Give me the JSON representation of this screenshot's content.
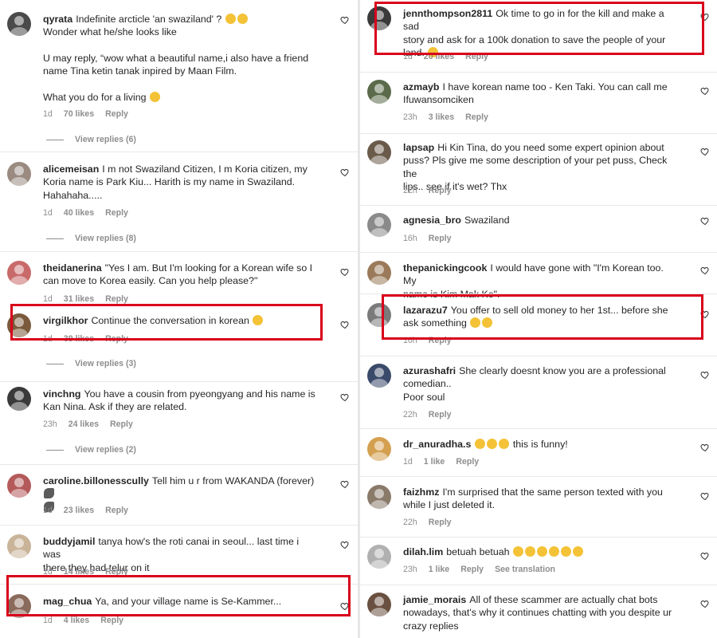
{
  "left": [
    {
      "user": "qyrata",
      "lines": [
        "Indefinite arcticle 'an swaziland' ?",
        "Wonder what he/she looks like",
        "",
        "U may reply, “wow what a beautiful name,i also have a friend",
        "name Tina ketin tanak inpired by Maan Film.",
        "",
        "What you do for a living"
      ],
      "time": "1d",
      "likes": "70 likes",
      "reply": "Reply",
      "view_replies": "View replies (6)",
      "avatar_color": "#4a4a4a"
    },
    {
      "user": "alicemeisan",
      "lines": [
        "I m not Swaziland Citizen, I m Koria citizen, my",
        "Koria name is Park Kiu... Harith is my name in Swaziland.",
        "Hahahaha....."
      ],
      "time": "1d",
      "likes": "40 likes",
      "reply": "Reply",
      "view_replies": "View replies (8)",
      "avatar_color": "#9a8a80"
    },
    {
      "user": "theidanerina",
      "lines": [
        "\"Yes I am. But I'm looking for a Korean wife so I",
        "can move to Korea easily. Can you help please?\""
      ],
      "time": "1d",
      "likes": "31 likes",
      "reply": "Reply",
      "avatar_color": "#c96a6a"
    },
    {
      "user": "virgilkhor",
      "lines": [
        "Continue the conversation in korean"
      ],
      "time": "1d",
      "likes": "39 likes",
      "reply": "Reply",
      "view_replies": "View replies (3)",
      "avatar_color": "#7a5a3a"
    },
    {
      "user": "vinchng",
      "lines": [
        "You have a cousin from pyeongyang and his name is",
        "Kan Nina. Ask if they are related."
      ],
      "time": "23h",
      "likes": "24 likes",
      "reply": "Reply",
      "view_replies": "View replies (2)",
      "avatar_color": "#3a3a3a"
    },
    {
      "user": "caroline.billonesscully",
      "lines": [
        "Tell him u r from WAKANDA (forever)"
      ],
      "time": "1d",
      "likes": "23 likes",
      "reply": "Reply",
      "avatar_color": "#b45a5a"
    },
    {
      "user": "buddyjamil",
      "lines": [
        "tanya how's the roti canai in seoul... last time i was",
        "there they had telur on it"
      ],
      "time": "1d",
      "likes": "14 likes",
      "reply": "Reply",
      "avatar_color": "#c9b49a"
    },
    {
      "user": "mag_chua",
      "lines": [
        "Ya, and your village name is Se-Kammer..."
      ],
      "time": "1d",
      "likes": "4 likes",
      "reply": "Reply",
      "avatar_color": "#8a6a5a"
    }
  ],
  "right": [
    {
      "user": "jennthompson2811",
      "lines": [
        "Ok time to go in for the kill and make a sad",
        "story and ask for a 100k donation to save the people of your",
        "land."
      ],
      "time": "1d",
      "likes": "20 likes",
      "reply": "Reply",
      "avatar_color": "#3a3a3a"
    },
    {
      "user": "azmayb",
      "lines": [
        "I have korean name too - Ken Taki. You can call me",
        "Ifuwansomciken"
      ],
      "time": "23h",
      "likes": "3 likes",
      "reply": "Reply",
      "avatar_color": "#5a6a4a"
    },
    {
      "user": "lapsap",
      "lines": [
        "Hi Kin Tina, do you need some expert opinion about",
        "puss? Pls give me some description of your pet puss, Check the",
        "lips.. see if it's wet? Thx"
      ],
      "time": "22h",
      "reply": "Reply",
      "avatar_color": "#6a5a4a"
    },
    {
      "user": "agnesia_bro",
      "lines": [
        "Swaziland"
      ],
      "time": "16h",
      "reply": "Reply",
      "avatar_color": "#8a8a8a"
    },
    {
      "user": "thepanickingcook",
      "lines": [
        "I would have gone with \"I'm Korean too. My",
        "name is Kim Mak Ko\"."
      ],
      "avatar_color": "#9a7a5a"
    },
    {
      "user": "lazarazu7",
      "lines": [
        "You offer to sell old money to her 1st... before she",
        "ask something"
      ],
      "time": "16h",
      "reply": "Reply",
      "avatar_color": "#7a7a7a"
    },
    {
      "user": "azurashafri",
      "lines": [
        "She clearly doesnt know you are a professional",
        "comedian..",
        "Poor soul"
      ],
      "time": "22h",
      "reply": "Reply",
      "avatar_color": "#3a4a6a"
    },
    {
      "user": "dr_anuradha.s",
      "lines": [
        "this is funny!"
      ],
      "time": "1d",
      "likes": "1 like",
      "reply": "Reply",
      "avatar_color": "#d4a050"
    },
    {
      "user": "faizhmz",
      "lines": [
        "I'm surprised that the same person texted with you",
        "while I just deleted it."
      ],
      "time": "22h",
      "reply": "Reply",
      "avatar_color": "#8a7a6a"
    },
    {
      "user": "dilah.lim",
      "lines": [
        "betuah betuah"
      ],
      "time": "23h",
      "likes": "1 like",
      "reply": "Reply",
      "see_translation": "See translation",
      "avatar_color": "#b0b0b0"
    },
    {
      "user": "jamie_morais",
      "lines": [
        "All of these scammer are actually chat bots",
        "nowadays, that's why it continues chatting with you despite ur",
        "crazy replies"
      ],
      "avatar_color": "#6a5040"
    }
  ],
  "colors": {
    "highlight": "#d9001b",
    "text": "#262626",
    "meta": "#8e8e8e"
  }
}
